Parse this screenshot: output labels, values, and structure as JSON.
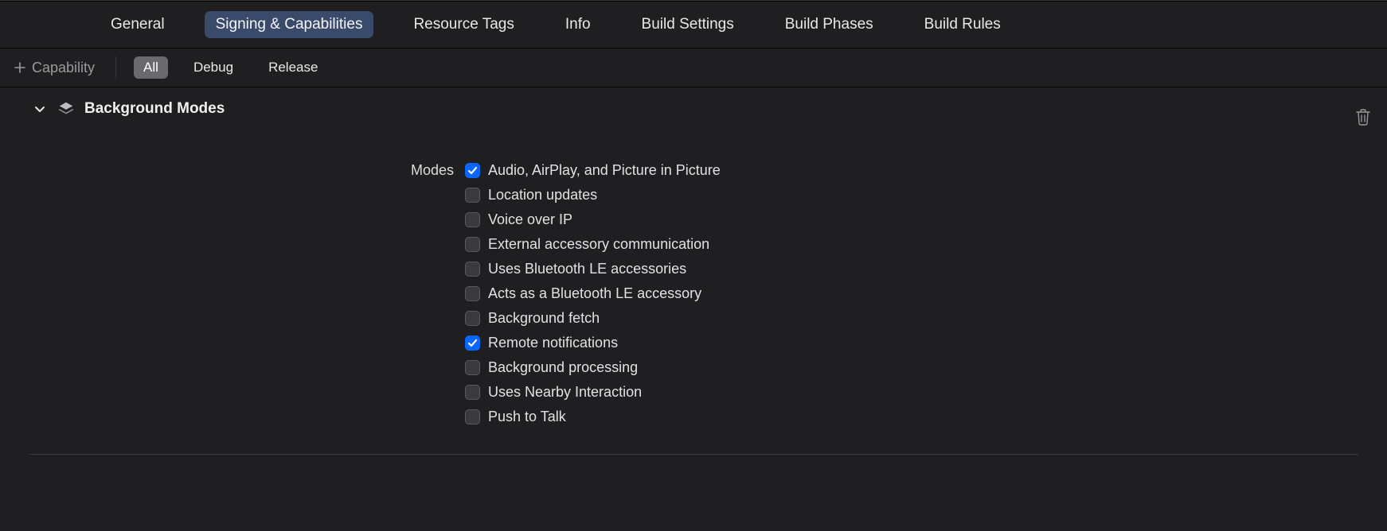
{
  "tabs": {
    "items": [
      {
        "label": "General",
        "active": false
      },
      {
        "label": "Signing & Capabilities",
        "active": true
      },
      {
        "label": "Resource Tags",
        "active": false
      },
      {
        "label": "Info",
        "active": false
      },
      {
        "label": "Build Settings",
        "active": false
      },
      {
        "label": "Build Phases",
        "active": false
      },
      {
        "label": "Build Rules",
        "active": false
      }
    ]
  },
  "filter": {
    "add_label": "Capability",
    "segments": [
      {
        "label": "All",
        "active": true
      },
      {
        "label": "Debug",
        "active": false
      },
      {
        "label": "Release",
        "active": false
      }
    ]
  },
  "capability": {
    "title": "Background Modes",
    "field_label": "Modes",
    "options": [
      {
        "label": "Audio, AirPlay, and Picture in Picture",
        "checked": true
      },
      {
        "label": "Location updates",
        "checked": false
      },
      {
        "label": "Voice over IP",
        "checked": false
      },
      {
        "label": "External accessory communication",
        "checked": false
      },
      {
        "label": "Uses Bluetooth LE accessories",
        "checked": false
      },
      {
        "label": "Acts as a Bluetooth LE accessory",
        "checked": false
      },
      {
        "label": "Background fetch",
        "checked": false
      },
      {
        "label": "Remote notifications",
        "checked": true
      },
      {
        "label": "Background processing",
        "checked": false
      },
      {
        "label": "Uses Nearby Interaction",
        "checked": false
      },
      {
        "label": "Push to Talk",
        "checked": false
      }
    ]
  }
}
